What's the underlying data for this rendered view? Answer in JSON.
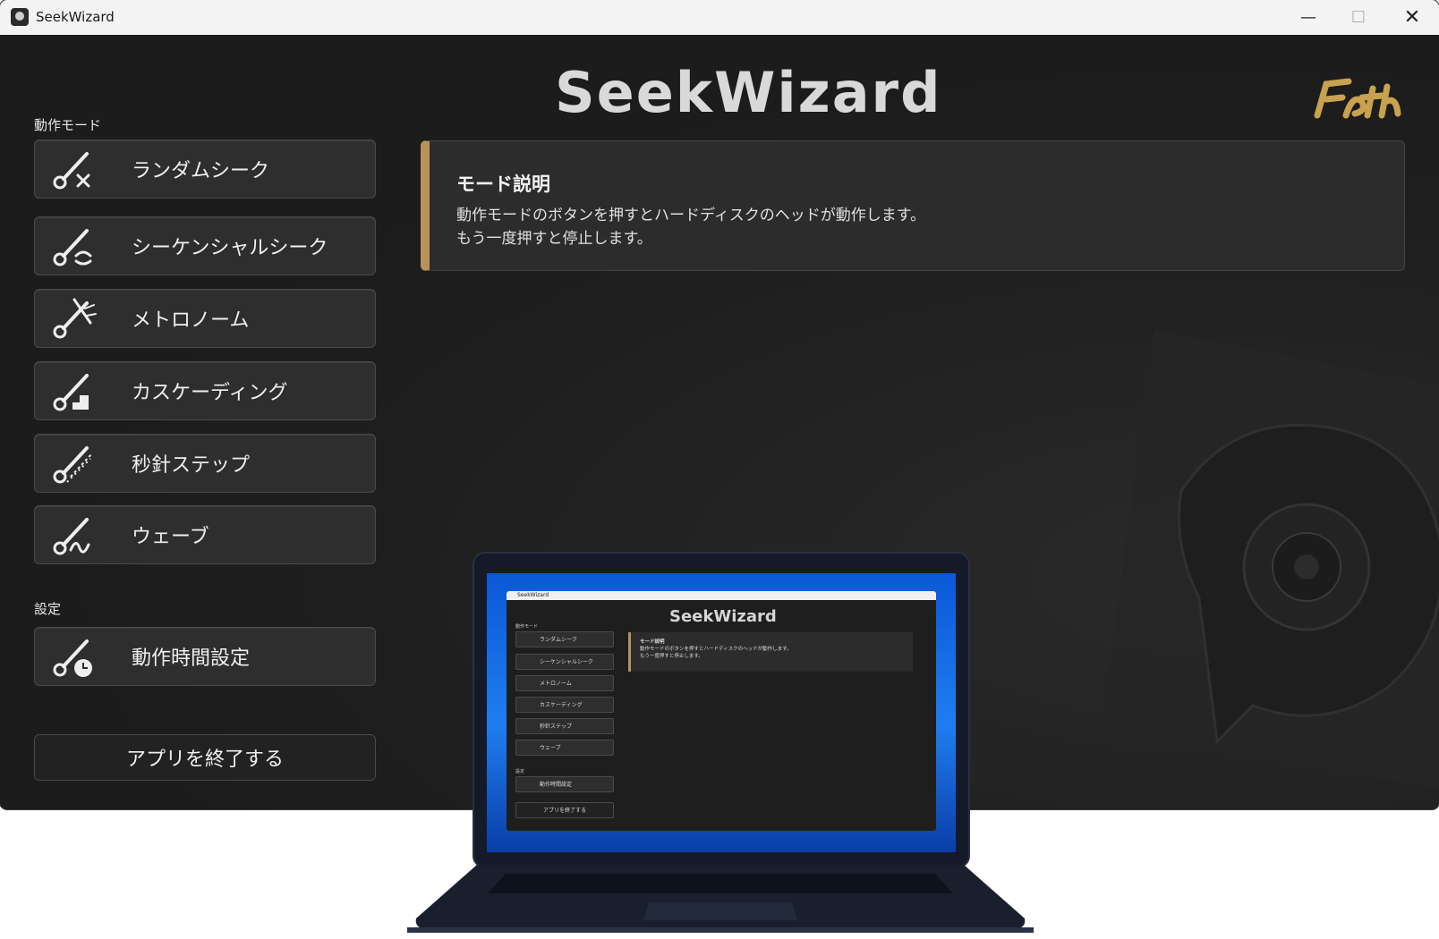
{
  "window": {
    "title": "SeekWizard",
    "controls": {
      "minimize": "—",
      "maximize": "☐",
      "close": "✕"
    }
  },
  "header": {
    "logo": "SeekWizard",
    "brand_mark": "Goth"
  },
  "sidebar": {
    "mode_label": "動作モード",
    "modes": [
      {
        "label": "ランダムシーク",
        "icon": "random-seek-icon"
      },
      {
        "label": "シーケンシャルシーク",
        "icon": "sequential-seek-icon"
      },
      {
        "label": "メトロノーム",
        "icon": "metronome-icon"
      },
      {
        "label": "カスケーディング",
        "icon": "cascading-icon"
      },
      {
        "label": "秒針ステップ",
        "icon": "second-hand-icon"
      },
      {
        "label": "ウェーブ",
        "icon": "wave-icon"
      }
    ],
    "settings_label": "設定",
    "settings_button": {
      "label": "動作時間設定",
      "icon": "timer-icon"
    },
    "exit_button": "アプリを終了する"
  },
  "description": {
    "title": "モード説明",
    "line1": "動作モードのボタンを押すとハードディスクのヘッドが動作します。",
    "line2": "もう一度押すと停止します。"
  },
  "mockup": {
    "title": "SeekWizard",
    "logo": "SeekWizard",
    "mode_label": "動作モード",
    "modes": [
      "ランダムシーク",
      "シーケンシャルシーク",
      "メトロノーム",
      "カスケーディング",
      "秒針ステップ",
      "ウェーブ"
    ],
    "settings_label": "設定",
    "settings_button": "動作時間設定",
    "exit_button": "アプリを終了する",
    "desc_title": "モード説明",
    "desc_line1": "動作モードのボタンを押すとハードディスクのヘッドが動作します。",
    "desc_line2": "もう一度押すと停止します。"
  },
  "colors": {
    "accent": "#b8925a",
    "background": "#1f1f1f",
    "button": "#2e2e2e"
  }
}
